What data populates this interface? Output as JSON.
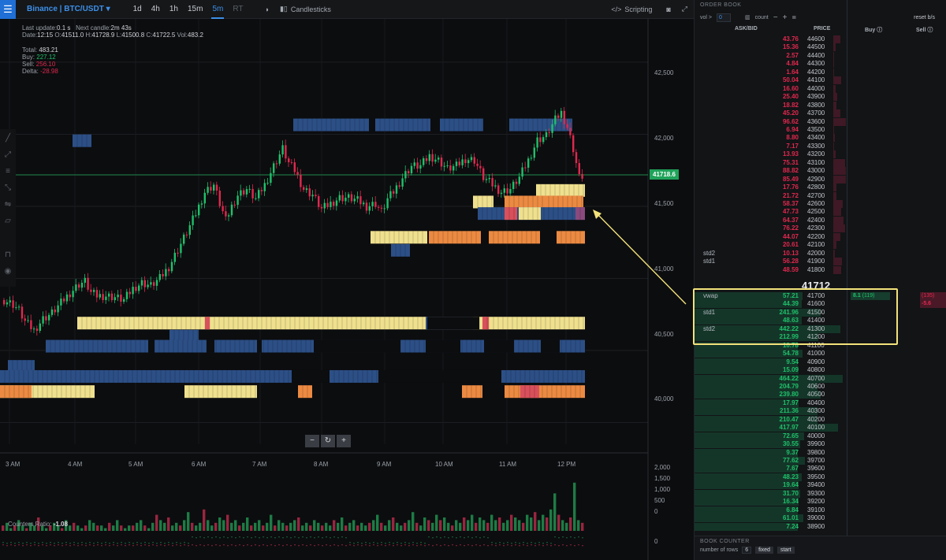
{
  "toolbar": {
    "menu_icon": "hamburger-icon",
    "symbol": "Binance | BTC/USDT",
    "timeframes": [
      "1d",
      "4h",
      "1h",
      "15m",
      "5m",
      "RT"
    ],
    "active_timeframe": "5m",
    "candlesticks_label": "Candlesticks",
    "scripting_label": "Scripting"
  },
  "info": {
    "last_update_label": "Last update:",
    "last_update": "0.1 s",
    "next_candle_label": "Next candle:",
    "next_candle": "2m 43s",
    "date_label": "Date:",
    "date": "12:15",
    "o_label": "O:",
    "o": "41511.0",
    "h_label": "H:",
    "h": "41728.9",
    "l_label": "L:",
    "l": "41500.8",
    "c_label": "C:",
    "c": "41722.5",
    "vol_label": "Vol:",
    "vol": "483.2",
    "total_label": "Total:",
    "total": "483.21",
    "buy_label": "Buy:",
    "buy": "227.12",
    "sell_label": "Sell:",
    "sell": "256.10",
    "delta_label": "Delta:",
    "delta": "-28.98"
  },
  "chart_data": {
    "type": "candlestick",
    "price_axis": [
      "42,500",
      "42,000",
      "41,500",
      "41,000",
      "40,500",
      "40,000"
    ],
    "time_axis": [
      "3 AM",
      "4 AM",
      "5 AM",
      "6 AM",
      "7 AM",
      "8 AM",
      "9 AM",
      "10 AM",
      "11 AM",
      "12 PM"
    ],
    "volume_axis": [
      "2,000",
      "1,500",
      "1,000",
      "500",
      "0"
    ],
    "counters_axis": [
      "0"
    ],
    "current_price": "41718.6",
    "ylim": [
      39850,
      42800
    ],
    "close_path": [
      [
        0,
        40850
      ],
      [
        3,
        40820
      ],
      [
        5,
        40780
      ],
      [
        7,
        40700
      ],
      [
        10,
        40640
      ],
      [
        13,
        40720
      ],
      [
        16,
        40760
      ],
      [
        19,
        40830
      ],
      [
        22,
        40900
      ],
      [
        25,
        40960
      ],
      [
        27,
        40980
      ],
      [
        29,
        40900
      ],
      [
        31,
        40880
      ],
      [
        34,
        40880
      ],
      [
        37,
        40870
      ],
      [
        40,
        40850
      ],
      [
        43,
        40930
      ],
      [
        46,
        40970
      ],
      [
        49,
        40950
      ],
      [
        52,
        41000
      ],
      [
        55,
        41080
      ],
      [
        58,
        41200
      ],
      [
        61,
        41320
      ],
      [
        64,
        41450
      ],
      [
        67,
        41600
      ],
      [
        70,
        41650
      ],
      [
        72,
        41520
      ],
      [
        74,
        41400
      ],
      [
        76,
        41500
      ],
      [
        78,
        41580
      ],
      [
        81,
        41620
      ],
      [
        84,
        41550
      ],
      [
        87,
        41650
      ],
      [
        90,
        41780
      ],
      [
        93,
        41900
      ],
      [
        95,
        41800
      ],
      [
        97,
        41750
      ],
      [
        100,
        41620
      ],
      [
        103,
        41580
      ],
      [
        106,
        41480
      ],
      [
        109,
        41520
      ],
      [
        112,
        41560
      ],
      [
        115,
        41560
      ],
      [
        118,
        41540
      ],
      [
        121,
        41500
      ],
      [
        124,
        41520
      ],
      [
        126,
        41460
      ],
      [
        128,
        41550
      ],
      [
        130,
        41600
      ],
      [
        133,
        41700
      ],
      [
        136,
        41780
      ],
      [
        139,
        41780
      ],
      [
        142,
        41850
      ],
      [
        145,
        41820
      ],
      [
        148,
        41760
      ],
      [
        151,
        41780
      ],
      [
        154,
        41830
      ],
      [
        157,
        41820
      ],
      [
        160,
        41700
      ],
      [
        163,
        41650
      ],
      [
        166,
        41600
      ],
      [
        169,
        41620
      ],
      [
        172,
        41700
      ],
      [
        175,
        41820
      ],
      [
        178,
        41960
      ],
      [
        181,
        41990
      ],
      [
        184,
        42100
      ],
      [
        186,
        42150
      ],
      [
        188,
        42050
      ],
      [
        190,
        41900
      ],
      [
        192,
        41700
      ],
      [
        194,
        41720
      ]
    ],
    "volume_bars": [
      2,
      3,
      1,
      2,
      4,
      2,
      1,
      3,
      2,
      5,
      2,
      1,
      2,
      3,
      2,
      1,
      4,
      2,
      3,
      2,
      1,
      2,
      4,
      3,
      2,
      2,
      1,
      3,
      2,
      4,
      2,
      1,
      2,
      2,
      3,
      4,
      2,
      1,
      3,
      6,
      4,
      3,
      5,
      2,
      3,
      2,
      4,
      7,
      3,
      2,
      3,
      8,
      4,
      2,
      3,
      5,
      4,
      6,
      3,
      4,
      2,
      3,
      5,
      2,
      3,
      4,
      2,
      3,
      6,
      2,
      4,
      3,
      2,
      3,
      4,
      5,
      2,
      3,
      2,
      4,
      3,
      2,
      3,
      2,
      4,
      3,
      5,
      2,
      3,
      4,
      2,
      3,
      2,
      3,
      4,
      6,
      3,
      2,
      4,
      5,
      3,
      2,
      3,
      4,
      7,
      3,
      2,
      5,
      4,
      3,
      6,
      4,
      5,
      3,
      2,
      4,
      3,
      5,
      4,
      6,
      3,
      5,
      4,
      3,
      6,
      4,
      5,
      3,
      4,
      6,
      5,
      4,
      3,
      6,
      5,
      7,
      4,
      6,
      5,
      8,
      14,
      6,
      4,
      3,
      5,
      18,
      4,
      3
    ]
  },
  "order_book": {
    "title": "ORDER BOOK",
    "vol_label": "vol >",
    "vol_value": "0",
    "count_label": "count",
    "reset_label": "reset b/s",
    "columns": {
      "askbid": "ASK/BID",
      "price": "PRICE",
      "buy": "Buy",
      "sell": "Sell"
    },
    "asks": [
      [
        "43.76",
        "44600"
      ],
      [
        "15.36",
        "44500"
      ],
      [
        "2.57",
        "44400"
      ],
      [
        "4.84",
        "44300"
      ],
      [
        "1.64",
        "44200"
      ],
      [
        "50.04",
        "44100"
      ],
      [
        "16.60",
        "44000"
      ],
      [
        "25.40",
        "43900"
      ],
      [
        "18.82",
        "43800"
      ],
      [
        "45.20",
        "43700"
      ],
      [
        "96.62",
        "43600"
      ],
      [
        "6.94",
        "43500"
      ],
      [
        "8.80",
        "43400"
      ],
      [
        "7.17",
        "43300"
      ],
      [
        "13.93",
        "43200"
      ],
      [
        "75.31",
        "43100"
      ],
      [
        "88.82",
        "43000"
      ],
      [
        "85.49",
        "42900"
      ],
      [
        "17.76",
        "42800"
      ],
      [
        "21.72",
        "42700"
      ],
      [
        "58.37",
        "42600"
      ],
      [
        "47.73",
        "42500"
      ],
      [
        "64.37",
        "42400"
      ],
      [
        "76.22",
        "42300"
      ],
      [
        "44.07",
        "42200"
      ],
      [
        "20.61",
        "42100"
      ],
      [
        "10.13",
        "42000"
      ],
      [
        "56.28",
        "41900"
      ],
      [
        "48.59",
        "41800"
      ]
    ],
    "ask_labels": {
      "26": "std2",
      "27": "std1"
    },
    "spread": "41712",
    "bids": [
      [
        "57.21",
        "41700"
      ],
      [
        "44.39",
        "41600"
      ],
      [
        "241.96",
        "41500"
      ],
      [
        "48.63",
        "41400"
      ],
      [
        "442.22",
        "41300"
      ],
      [
        "212.99",
        "41200"
      ],
      [
        "10.78",
        "41100"
      ],
      [
        "54.78",
        "41000"
      ],
      [
        "9.54",
        "40900"
      ],
      [
        "15.09",
        "40800"
      ],
      [
        "464.22",
        "40700"
      ],
      [
        "204.79",
        "40600"
      ],
      [
        "239.80",
        "40500"
      ],
      [
        "17.97",
        "40400"
      ],
      [
        "211.36",
        "40300"
      ],
      [
        "210.47",
        "40200"
      ],
      [
        "417.97",
        "40100"
      ],
      [
        "72.65",
        "40000"
      ],
      [
        "30.55",
        "39900"
      ],
      [
        "9.37",
        "39800"
      ],
      [
        "77.62",
        "39700"
      ],
      [
        "7.67",
        "39600"
      ],
      [
        "48.23",
        "39500"
      ],
      [
        "19.64",
        "39400"
      ],
      [
        "31.70",
        "39300"
      ],
      [
        "16.34",
        "39200"
      ],
      [
        "6.84",
        "39100"
      ],
      [
        "61.01",
        "39000"
      ],
      [
        "7.24",
        "38900"
      ]
    ],
    "bid_labels": {
      "0": "vwap",
      "2": "std1",
      "4": "std2"
    },
    "buy_trade": "8.1",
    "buy_trade_count": "(119)",
    "sell_trade_count": "(135)",
    "sell_trade": "-5.6",
    "book_counter": {
      "title": "BOOK COUNTER",
      "rows_label": "number of rows",
      "rows_value": "6",
      "fixed_label": "fixed",
      "start_label": "start"
    }
  },
  "counters": {
    "label": "Counters Ratio:",
    "value": "-1.08"
  },
  "colors": {
    "up": "#1fc06a",
    "down": "#e0284e",
    "accent": "#3d8fe8",
    "highlight": "#f2e27a"
  }
}
